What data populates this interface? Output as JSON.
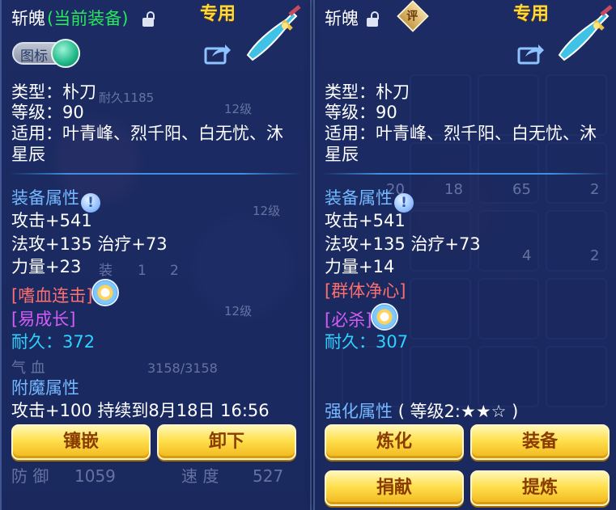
{
  "left": {
    "title": "斩魄",
    "title_suffix": "(当前装备)",
    "exclusive": "专用",
    "toggle_label": "图标",
    "type": "类型：朴刀",
    "level": "等级：90",
    "applies_line1": "适用：叶青峰、烈千阳、白无忧、沐",
    "applies_line2": "星辰",
    "attr_header": "装备属性",
    "attack": "攻击+541",
    "magic_heal": "法攻+135 治疗+73",
    "strength": "力量+23",
    "skill1": "[嗜血连击]",
    "skill2": "[易成长]",
    "durability_label": "耐久：",
    "durability_value": "372",
    "enchant_header": "附魔属性",
    "enchant_line": "攻击+100 持续到8月18日 16:56",
    "buttons": [
      "镶嵌",
      "卸下"
    ]
  },
  "right": {
    "title": "斩魄",
    "rating_badge": "评",
    "exclusive": "专用",
    "type": "类型：朴刀",
    "level": "等级：90",
    "applies_line1": "适用：叶青峰、烈千阳、白无忧、沐",
    "applies_line2": "星辰",
    "attr_header": "装备属性",
    "attack": "攻击+541",
    "magic_heal": "法攻+135 治疗+73",
    "strength": "力量+14",
    "skill1": "[群体净心]",
    "skill2": "[必杀]",
    "durability_label": "耐久：",
    "durability_value": "307",
    "enhance_header": "强化属性",
    "enhance_level": "( 等级2:★★☆ )",
    "buttons": [
      "炼化",
      "装备",
      "捐献",
      "提炼"
    ]
  },
  "background": {
    "durability_text": "耐久1185",
    "level_labels": [
      "12级",
      "12级",
      "12级"
    ],
    "numbers": [
      "20",
      "18",
      "65",
      "2",
      "4",
      "2"
    ],
    "tabs": [
      "装",
      "1",
      "2"
    ],
    "hp_label": "气 血",
    "hp_value": "3158/3158",
    "defense_label": "防 御",
    "defense_value": "1059",
    "speed_label": "速 度",
    "speed_value": "527"
  },
  "colors": {
    "title_suffix": "#27e85c",
    "exclusive": "#ffd83a",
    "skill_primary": "#ff6e6e",
    "skill_secondary": "#d45cf5",
    "durability": "#2fd1ff",
    "section_header": "#74b9ff",
    "button_text": "#8a3b00"
  },
  "icons": [
    "lock-open-icon",
    "share-icon",
    "weapon-icon",
    "info-icon",
    "skill-swirl-icon",
    "rating-badge-icon",
    "toggle-knob-icon"
  ]
}
